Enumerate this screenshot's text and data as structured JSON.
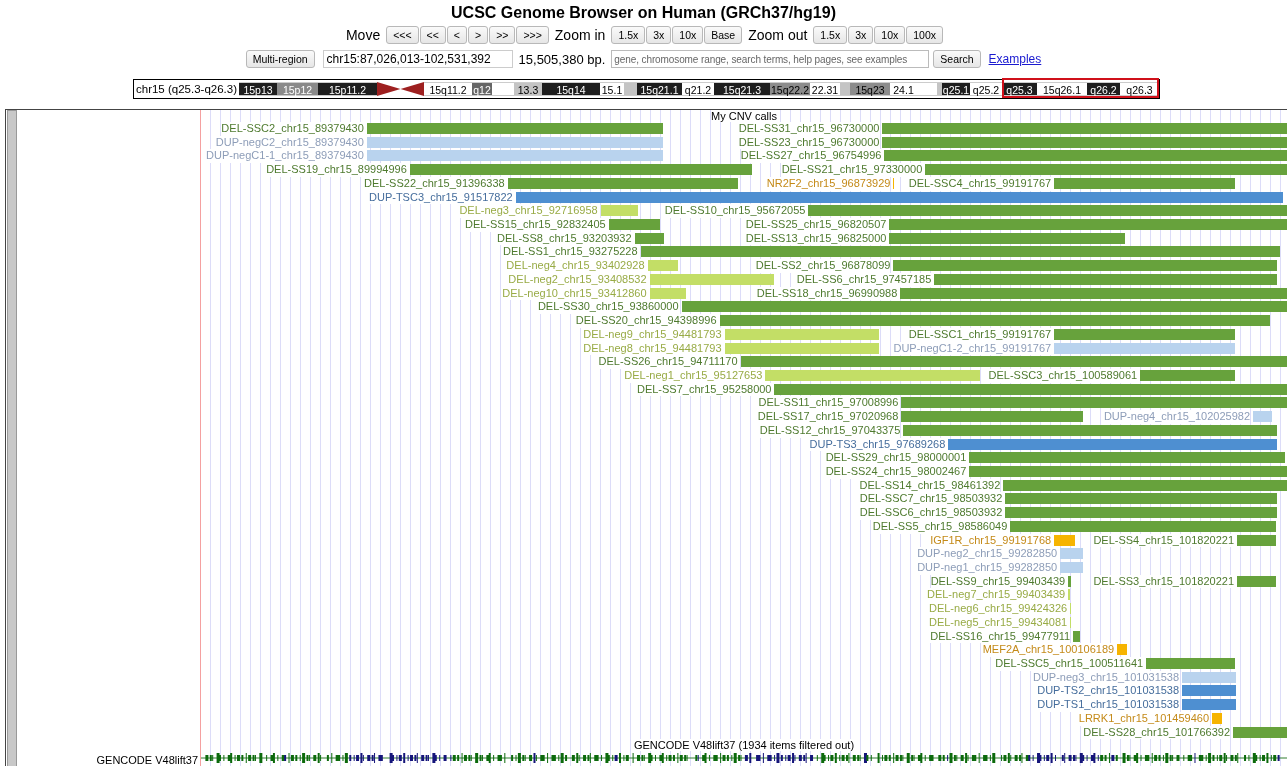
{
  "header": {
    "title": "UCSC Genome Browser on Human (GRCh37/hg19)"
  },
  "navigation": {
    "move_label": "Move",
    "move_buttons": [
      "<<<",
      "<<",
      "<",
      ">",
      ">>",
      ">>>"
    ],
    "zoom_in_label": "Zoom in",
    "zoom_in_buttons": [
      "1.5x",
      "3x",
      "10x",
      "Base"
    ],
    "zoom_out_label": "Zoom out",
    "zoom_out_buttons": [
      "1.5x",
      "3x",
      "10x",
      "100x"
    ]
  },
  "position_bar": {
    "multi_region_button": "Multi-region",
    "position": "chr15:87,026,013-102,531,392",
    "size": "15,505,380 bp.",
    "search_placeholder": "gene, chromosome range, search terms, help pages, see examples",
    "search_button": "Search",
    "examples_link": "Examples"
  },
  "ideogram": {
    "label": "chr15 (q25.3-q26.3)",
    "bands": [
      {
        "label": "15p13",
        "kind": "gpos100",
        "in_view": false
      },
      {
        "label": "15p12",
        "kind": "gvar",
        "in_view": false
      },
      {
        "label": "15p11.2",
        "kind": "gpos100",
        "in_view": false
      },
      {
        "kind": "acen",
        "in_view": false
      },
      {
        "label": "15q11.2",
        "kind": "gneg",
        "in_view": false
      },
      {
        "label": "q12",
        "kind": "gpos75",
        "in_view": false
      },
      {
        "kind": "gneg",
        "in_view": false
      },
      {
        "label": "13.3",
        "kind": "gpos25",
        "in_view": false
      },
      {
        "label": "15q14",
        "kind": "gpos100",
        "in_view": false
      },
      {
        "label": "15.1",
        "kind": "gneg",
        "in_view": false
      },
      {
        "kind": "gpos25",
        "in_view": false
      },
      {
        "label": "15q21.1",
        "kind": "gpos100",
        "in_view": false
      },
      {
        "label": "q21.2",
        "kind": "gneg",
        "in_view": false
      },
      {
        "label": "15q21.3",
        "kind": "gpos100",
        "in_view": false
      },
      {
        "label": "15q22.2",
        "kind": "gpos50",
        "in_view": false
      },
      {
        "label": "22.31",
        "kind": "gneg",
        "in_view": false
      },
      {
        "kind": "gpos25",
        "in_view": false
      },
      {
        "label": "15q23",
        "kind": "gpos50",
        "in_view": false
      },
      {
        "label": "24.1",
        "kind": "gneg",
        "in_view": false
      },
      {
        "kind": "gneg",
        "in_view": false
      },
      {
        "kind": "gpos25",
        "in_view": false
      },
      {
        "label": "q25.1",
        "kind": "gpos100",
        "in_view": false
      },
      {
        "label": "q25.2",
        "kind": "gneg",
        "in_view": false
      },
      {
        "label": "q25.3",
        "kind": "gpos100",
        "in_view": true
      },
      {
        "label": "15q26.1",
        "kind": "gneg",
        "in_view": true
      },
      {
        "label": "q26.2",
        "kind": "gpos100",
        "in_view": true
      },
      {
        "label": "q26.3",
        "kind": "gneg",
        "in_view": true
      }
    ]
  },
  "cnv_track": {
    "title": "My CNV calls",
    "rows": [
      {
        "features": [
          {
            "label": "DEL-SSC2_chr15_89379430",
            "kind": "del-case"
          },
          {
            "label": "DEL-SS31_chr15_96730000",
            "kind": "del-case"
          }
        ]
      },
      {
        "features": [
          {
            "label": "DUP-negC2_chr15_89379430",
            "kind": "dup-control"
          },
          {
            "label": "DEL-SS23_chr15_96730000",
            "kind": "del-case"
          }
        ]
      },
      {
        "features": [
          {
            "label": "DUP-negC1-1_chr15_89379430",
            "kind": "dup-control"
          },
          {
            "label": "DEL-SS27_chr15_96754996",
            "kind": "del-case"
          }
        ]
      },
      {
        "features": [
          {
            "label": "DEL-SS19_chr15_89994996",
            "kind": "del-case"
          },
          {
            "label": "DEL-SS21_chr15_97330000",
            "kind": "del-case"
          }
        ]
      },
      {
        "features": [
          {
            "label": "DEL-SS22_chr15_91396338",
            "kind": "del-case"
          },
          {
            "label": "NR2F2_chr15_96873929",
            "kind": "gene"
          },
          {
            "label": "DEL-SSC4_chr15_99191767",
            "kind": "del-case"
          }
        ]
      },
      {
        "features": [
          {
            "label": "DUP-TSC3_chr15_91517822",
            "kind": "dup-case"
          }
        ]
      },
      {
        "features": [
          {
            "label": "DEL-neg3_chr15_92716958",
            "kind": "del-control"
          },
          {
            "label": "DEL-SS10_chr15_95672055",
            "kind": "del-case"
          }
        ]
      },
      {
        "features": [
          {
            "label": "DEL-SS15_chr15_92832405",
            "kind": "del-case"
          },
          {
            "label": "DEL-SS25_chr15_96820507",
            "kind": "del-case"
          }
        ]
      },
      {
        "features": [
          {
            "label": "DEL-SS8_chr15_93203932",
            "kind": "del-case"
          },
          {
            "label": "DEL-SS13_chr15_96825000",
            "kind": "del-case"
          }
        ]
      },
      {
        "features": [
          {
            "label": "DEL-SS1_chr15_93275228",
            "kind": "del-case"
          }
        ]
      },
      {
        "features": [
          {
            "label": "DEL-neg4_chr15_93402928",
            "kind": "del-control"
          },
          {
            "label": "DEL-SS2_chr15_96878099",
            "kind": "del-case"
          }
        ]
      },
      {
        "features": [
          {
            "label": "DEL-neg2_chr15_93408532",
            "kind": "del-control"
          },
          {
            "label": "DEL-SS6_chr15_97457185",
            "kind": "del-case"
          }
        ]
      },
      {
        "features": [
          {
            "label": "DEL-neg10_chr15_93412860",
            "kind": "del-control"
          },
          {
            "label": "DEL-SS18_chr15_96990988",
            "kind": "del-case"
          }
        ]
      },
      {
        "features": [
          {
            "label": "DEL-SS30_chr15_93860000",
            "kind": "del-case"
          }
        ]
      },
      {
        "features": [
          {
            "label": "DEL-SS20_chr15_94398996",
            "kind": "del-case"
          }
        ]
      },
      {
        "features": [
          {
            "label": "DEL-neg9_chr15_94481793",
            "kind": "del-control"
          },
          {
            "label": "DEL-SSC1_chr15_99191767",
            "kind": "del-case"
          }
        ]
      },
      {
        "features": [
          {
            "label": "DEL-neg8_chr15_94481793",
            "kind": "del-control"
          },
          {
            "label": "DUP-negC1-2_chr15_99191767",
            "kind": "dup-control"
          }
        ]
      },
      {
        "features": [
          {
            "label": "DEL-SS26_chr15_94711170",
            "kind": "del-case"
          }
        ]
      },
      {
        "features": [
          {
            "label": "DEL-neg1_chr15_95127653",
            "kind": "del-control"
          },
          {
            "label": "DEL-SSC3_chr15_100589061",
            "kind": "del-case"
          }
        ]
      },
      {
        "features": [
          {
            "label": "DEL-SS7_chr15_95258000",
            "kind": "del-case"
          }
        ]
      },
      {
        "features": [
          {
            "label": "DEL-SS11_chr15_97008996",
            "kind": "del-case"
          }
        ]
      },
      {
        "features": [
          {
            "label": "DEL-SS17_chr15_97020968",
            "kind": "del-case"
          },
          {
            "label": "DUP-neg4_chr15_102025982",
            "kind": "dup-control"
          }
        ]
      },
      {
        "features": [
          {
            "label": "DEL-SS12_chr15_97043375",
            "kind": "del-case"
          }
        ]
      },
      {
        "features": [
          {
            "label": "DUP-TS3_chr15_97689268",
            "kind": "dup-case"
          }
        ]
      },
      {
        "features": [
          {
            "label": "DEL-SS29_chr15_98000001",
            "kind": "del-case"
          }
        ]
      },
      {
        "features": [
          {
            "label": "DEL-SS24_chr15_98002467",
            "kind": "del-case"
          }
        ]
      },
      {
        "features": [
          {
            "label": "DEL-SS14_chr15_98461392",
            "kind": "del-case"
          }
        ]
      },
      {
        "features": [
          {
            "label": "DEL-SSC7_chr15_98503932",
            "kind": "del-case"
          }
        ]
      },
      {
        "features": [
          {
            "label": "DEL-SSC6_chr15_98503932",
            "kind": "del-case"
          }
        ]
      },
      {
        "features": [
          {
            "label": "DEL-SS5_chr15_98586049",
            "kind": "del-case"
          }
        ]
      },
      {
        "features": [
          {
            "label": "IGF1R_chr15_99191768",
            "kind": "gene"
          },
          {
            "label": "DEL-SS4_chr15_101820221",
            "kind": "del-case"
          }
        ]
      },
      {
        "features": [
          {
            "label": "DUP-neg2_chr15_99282850",
            "kind": "dup-control"
          }
        ]
      },
      {
        "features": [
          {
            "label": "DUP-neg1_chr15_99282850",
            "kind": "dup-control"
          }
        ]
      },
      {
        "features": [
          {
            "label": "DEL-SS9_chr15_99403439",
            "kind": "del-case"
          },
          {
            "label": "DEL-SS3_chr15_101820221",
            "kind": "del-case"
          }
        ]
      },
      {
        "features": [
          {
            "label": "DEL-neg7_chr15_99403439",
            "kind": "del-control"
          }
        ]
      },
      {
        "features": [
          {
            "label": "DEL-neg6_chr15_99424326",
            "kind": "del-control"
          }
        ]
      },
      {
        "features": [
          {
            "label": "DEL-neg5_chr15_99434081",
            "kind": "del-control"
          }
        ]
      },
      {
        "features": [
          {
            "label": "DEL-SS16_chr15_99477911",
            "kind": "del-case"
          }
        ]
      },
      {
        "features": [
          {
            "label": "MEF2A_chr15_100106189",
            "kind": "gene"
          }
        ]
      },
      {
        "features": [
          {
            "label": "DEL-SSC5_chr15_100511641",
            "kind": "del-case"
          }
        ]
      },
      {
        "features": [
          {
            "label": "DUP-neg3_chr15_101031538",
            "kind": "dup-control"
          }
        ]
      },
      {
        "features": [
          {
            "label": "DUP-TS2_chr15_101031538",
            "kind": "dup-case"
          }
        ]
      },
      {
        "features": [
          {
            "label": "DUP-TS1_chr15_101031538",
            "kind": "dup-case"
          }
        ]
      },
      {
        "features": [
          {
            "label": "LRRK1_chr15_101459460",
            "kind": "gene"
          }
        ]
      },
      {
        "features": [
          {
            "label": "DEL-SS28_chr15_101766392",
            "kind": "del-case"
          }
        ]
      }
    ]
  },
  "gene_track": {
    "title": "GENCODE V48lift37 (1934 items filtered out)",
    "name": "GENCODE V48lift37"
  }
}
